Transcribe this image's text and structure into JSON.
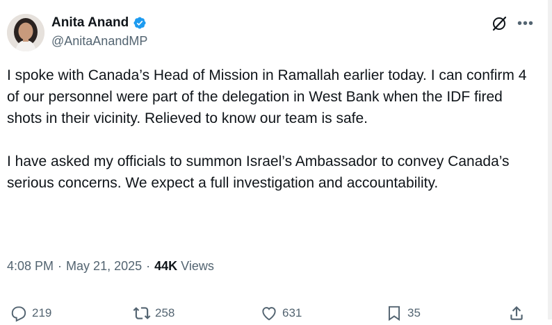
{
  "author": {
    "display_name": "Anita Anand",
    "handle": "@AnitaAnandMP"
  },
  "tweet": {
    "paragraphs": [
      "I spoke with Canada’s Head of Mission in Ramallah earlier today. I can confirm 4 of our personnel were part of the delegation in West Bank when the IDF fired shots in their vicinity. Relieved to know our team is safe.",
      "I have asked my officials to summon Israel’s Ambassador to convey Canada’s serious concerns. We expect a full investigation and accountability."
    ]
  },
  "meta": {
    "time": "4:08 PM",
    "date": "May 21, 2025",
    "views_count": "44K",
    "views_label": "Views",
    "separator": "·"
  },
  "actions": {
    "replies": "219",
    "reposts": "258",
    "likes": "631",
    "bookmarks": "35"
  },
  "icons": {
    "verified_color": "#1d9bf0",
    "icon_color": "#536471"
  }
}
